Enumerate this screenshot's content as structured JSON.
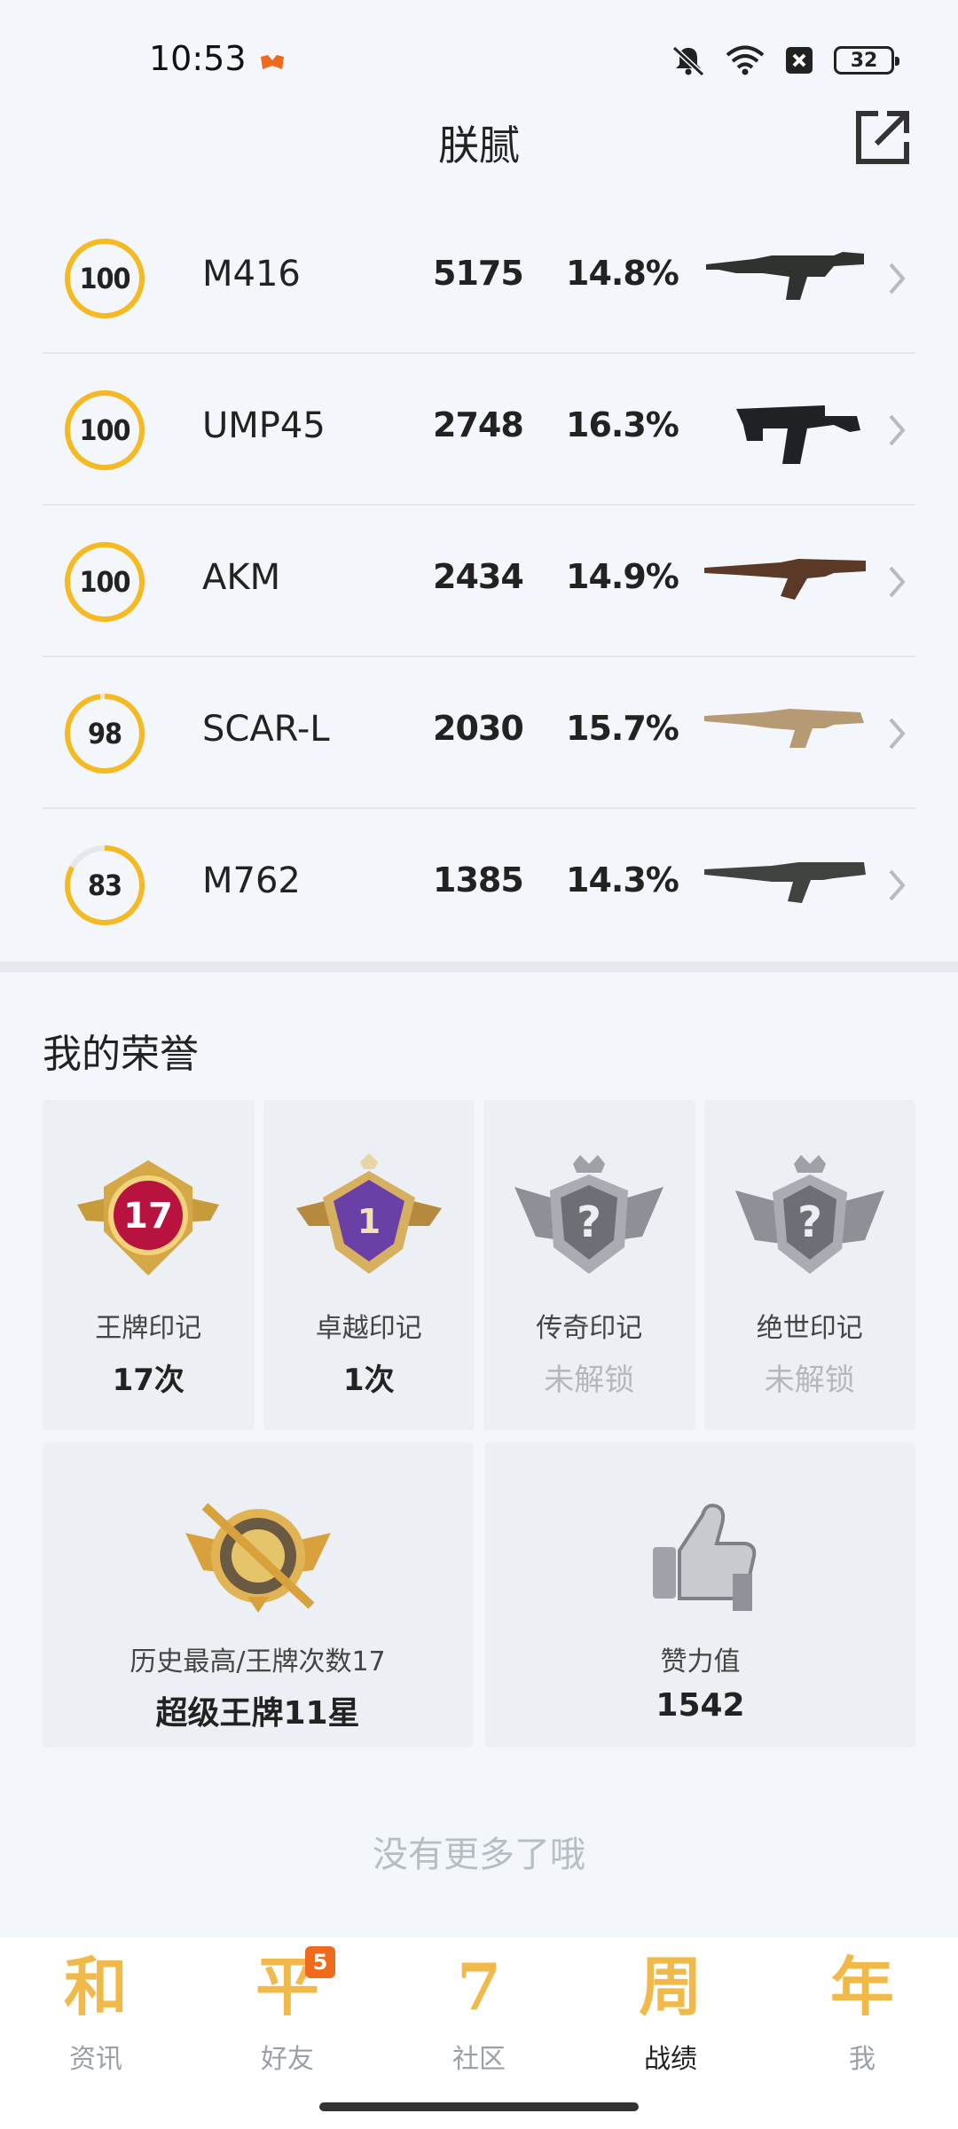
{
  "status_bar": {
    "time": "10:53",
    "battery": "32",
    "icons": [
      "mute-icon",
      "wifi-icon",
      "sim-off-icon",
      "battery-icon"
    ]
  },
  "header": {
    "title": "朕腻",
    "share_icon": "share-icon"
  },
  "weapons": [
    {
      "score": "100",
      "score_value": 100,
      "name": "M416",
      "kills": "5175",
      "rate": "14.8%"
    },
    {
      "score": "100",
      "score_value": 100,
      "name": "UMP45",
      "kills": "2748",
      "rate": "16.3%"
    },
    {
      "score": "100",
      "score_value": 100,
      "name": "AKM",
      "kills": "2434",
      "rate": "14.9%"
    },
    {
      "score": "98",
      "score_value": 98,
      "name": "SCAR-L",
      "kills": "2030",
      "rate": "15.7%"
    },
    {
      "score": "83",
      "score_value": 83,
      "name": "M762",
      "kills": "1385",
      "rate": "14.3%"
    }
  ],
  "honors": {
    "title": "我的荣誉",
    "marks": [
      {
        "badge_number": "17",
        "label": "王牌印记",
        "value": "17次",
        "locked": false
      },
      {
        "badge_number": "1",
        "label": "卓越印记",
        "value": "1次",
        "locked": false
      },
      {
        "badge_number": "?",
        "label": "传奇印记",
        "value": "未解锁",
        "locked": true
      },
      {
        "badge_number": "?",
        "label": "绝世印记",
        "value": "未解锁",
        "locked": true
      }
    ],
    "stats": [
      {
        "label": "历史最高/王牌次数17",
        "value": "超级王牌11星"
      },
      {
        "label": "赞力值",
        "value": "1542"
      }
    ]
  },
  "end_text": "没有更多了哦",
  "bottom_nav": [
    {
      "glyph": "和",
      "label": "资讯",
      "active": false
    },
    {
      "glyph": "平",
      "label": "好友",
      "active": false,
      "badge": "5"
    },
    {
      "glyph": "7",
      "label": "社区",
      "active": false
    },
    {
      "glyph": "周",
      "label": "战绩",
      "active": true
    },
    {
      "glyph": "年",
      "label": "我",
      "active": false
    }
  ],
  "colors": {
    "ring": "#f5b921",
    "ring_track": "#e4e7ec",
    "accent_nav": "#f0b94a",
    "badge": "#f06a1d"
  }
}
